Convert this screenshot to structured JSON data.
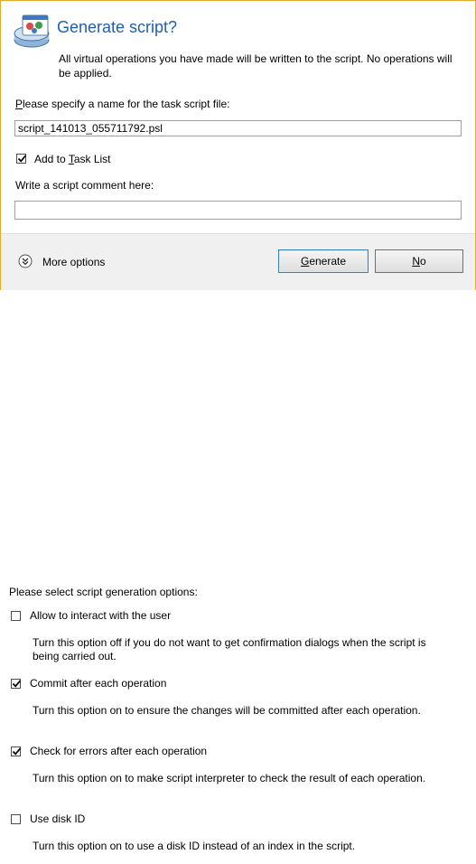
{
  "dialog": {
    "title": "Generate script?",
    "description": "All virtual operations you have made will be written to the script. No operations will be applied.",
    "name_label_mnemonic": "P",
    "name_label_rest": "lease specify a name for the task script file:",
    "name_value": "script_141013_055711792.psl",
    "add_to_task_list": {
      "checked": true,
      "label_prefix": "Add to ",
      "label_mnemonic": "T",
      "label_rest": "ask List"
    },
    "comment_label": "Write a script comment here:",
    "comment_value": "",
    "more_options_label": "More options",
    "generate_button": {
      "mnemonic": "G",
      "rest": "enerate"
    },
    "no_button": {
      "mnemonic": "N",
      "rest": "o"
    },
    "title_color": "#1f5fae",
    "border_color": "#e8a82c"
  },
  "options": {
    "heading": "Please select script generation options:",
    "items": [
      {
        "label": "Allow to interact with the user",
        "checked": false,
        "description": "Turn this option off if you do not want to get confirmation dialogs when the script is being carried out."
      },
      {
        "label": "Commit after each operation",
        "checked": true,
        "description": "Turn this option on to ensure the changes will be committed after each operation."
      },
      {
        "label": "Check for errors after each operation",
        "checked": true,
        "description": "Turn this option on to make script interpreter to check the result of each operation."
      },
      {
        "label": "Use disk ID",
        "checked": false,
        "description": "Turn this option on to use a disk ID instead of an index in the script."
      }
    ]
  },
  "icons": {
    "dialog_icon": "script-disk-icon",
    "more_options_icon": "chevron-double-down-icon",
    "check_icon": "checkmark-icon"
  }
}
